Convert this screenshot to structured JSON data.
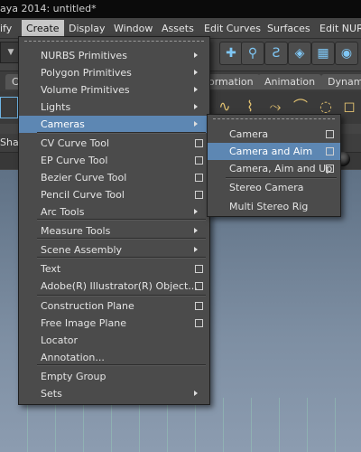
{
  "window": {
    "title": "aya 2014: untitled*"
  },
  "menubar": {
    "items": [
      "ify",
      "Create",
      "Display",
      "Window",
      "Assets",
      "Edit Curves",
      "Surfaces",
      "Edit NURB"
    ],
    "active": "Create"
  },
  "shelf_tabs": [
    "C",
    "ormation",
    "Animation",
    "Dynami"
  ],
  "panel": {
    "label": "Shad"
  },
  "create_menu": {
    "items": [
      {
        "label": "NURBS Primitives",
        "type": "submenu"
      },
      {
        "label": "Polygon Primitives",
        "type": "submenu"
      },
      {
        "label": "Volume Primitives",
        "type": "submenu"
      },
      {
        "label": "Lights",
        "type": "submenu"
      },
      {
        "label": "Cameras",
        "type": "submenu",
        "highlighted": true
      },
      {
        "label": "CV Curve Tool",
        "type": "option"
      },
      {
        "label": "EP Curve Tool",
        "type": "option"
      },
      {
        "label": "Bezier Curve Tool",
        "type": "option"
      },
      {
        "label": "Pencil Curve Tool",
        "type": "option"
      },
      {
        "label": "Arc Tools",
        "type": "submenu"
      },
      {
        "label": "Measure Tools",
        "type": "submenu"
      },
      {
        "label": "Scene Assembly",
        "type": "submenu"
      },
      {
        "label": "Text",
        "type": "option"
      },
      {
        "label": "Adobe(R) Illustrator(R) Object...",
        "type": "option"
      },
      {
        "label": "Construction Plane",
        "type": "option"
      },
      {
        "label": "Free Image Plane",
        "type": "option"
      },
      {
        "label": "Locator",
        "type": "plain"
      },
      {
        "label": "Annotation...",
        "type": "plain"
      },
      {
        "label": "Empty Group",
        "type": "plain"
      },
      {
        "label": "Sets",
        "type": "submenu"
      }
    ]
  },
  "cameras_submenu": {
    "items": [
      {
        "label": "Camera",
        "type": "option"
      },
      {
        "label": "Camera and Aim",
        "type": "option",
        "highlighted": true
      },
      {
        "label": "Camera, Aim and Up",
        "type": "option"
      },
      {
        "label": "Stereo Camera",
        "type": "plain"
      },
      {
        "label": "Multi Stereo Rig",
        "type": "plain"
      }
    ]
  },
  "colors": {
    "menu_bg": "#4b4b4b",
    "highlight": "#5d87b3",
    "title_bg": "#0b0b0b",
    "viewport": "#7e8fa3"
  }
}
